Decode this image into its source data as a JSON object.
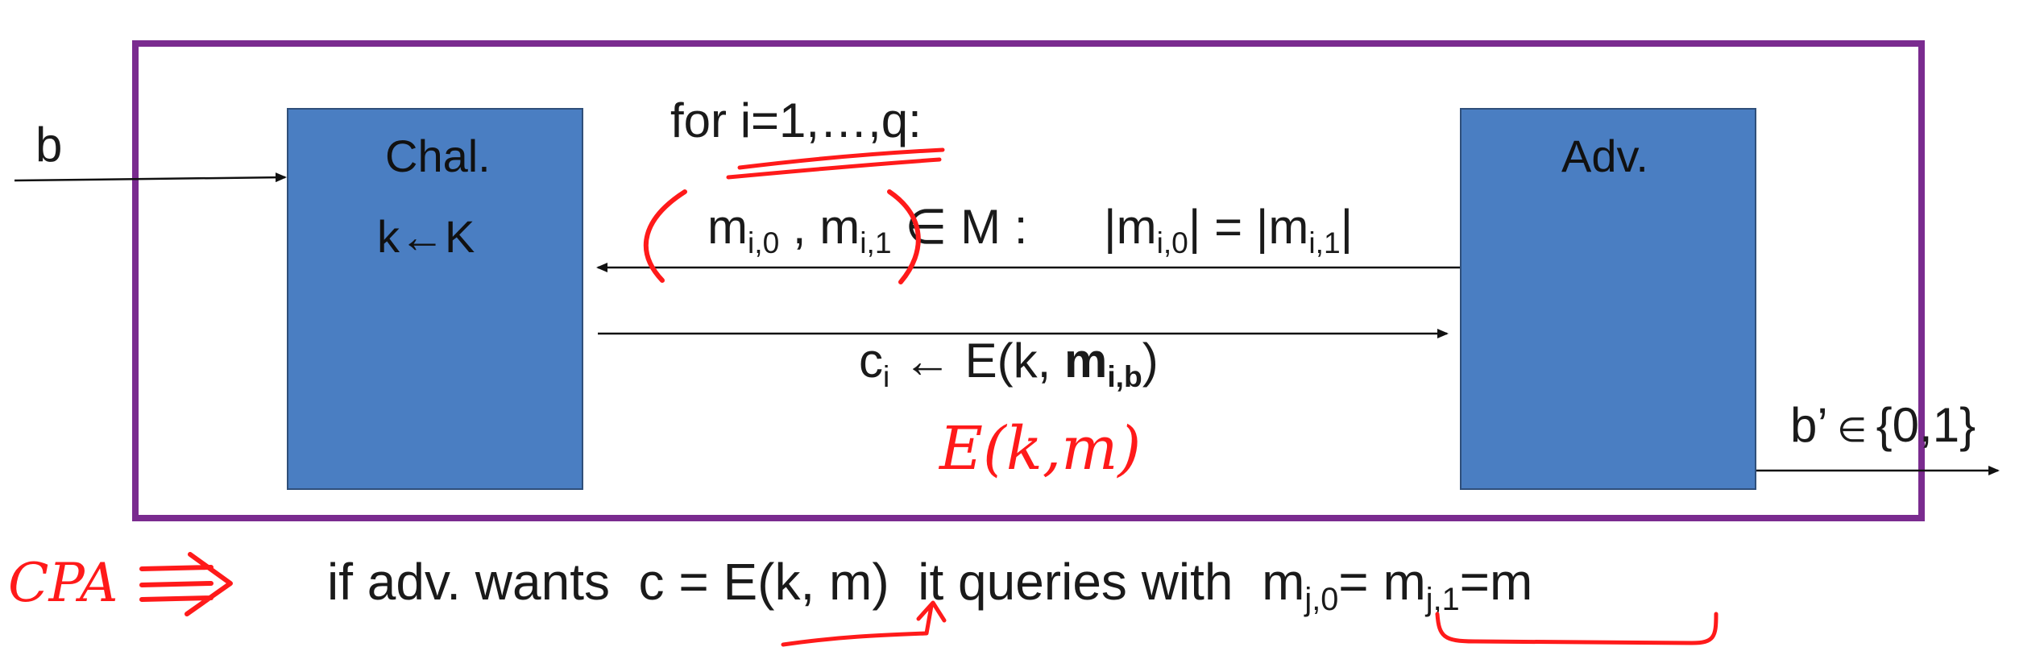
{
  "diagram": {
    "input_bit": "b",
    "challenger": {
      "title": "Chal.",
      "key_gen": "k←K"
    },
    "adversary": {
      "title": "Adv."
    },
    "loop": "for i=1,…,q:",
    "query": {
      "m0_base": "m",
      "m0_sub": "i,0",
      "comma": " , ",
      "m1_base": "m",
      "m1_sub": "i,1",
      "in_M": " ∈ M :",
      "cond_open": "|m",
      "cond_sub0": "i,0",
      "cond_mid": "| = |m",
      "cond_sub1": "i,1",
      "cond_close": "|"
    },
    "response": {
      "c_base": "c",
      "c_sub": "i",
      "arrow_E": " ← E(k, ",
      "m_base": "m",
      "m_sub": "i,b",
      "close": ")"
    },
    "output": {
      "base": "b’",
      "in": " ∈ ",
      "set": "{0,1}"
    },
    "footer": {
      "text1": "if adv. wants  c = E(k, m)  it queries with  ",
      "mj0_base": "m",
      "mj0_sub": "j,0",
      "eq": "= ",
      "mj1_base": "m",
      "mj1_sub": "j,1",
      "end": "=m"
    },
    "handwriting": {
      "note_E": "E(k,m)",
      "note_CPA": "CPA"
    },
    "colors": {
      "frame": "#7a2b8f",
      "box": "#4a7ec2",
      "ink": "#ff1a1a"
    }
  }
}
